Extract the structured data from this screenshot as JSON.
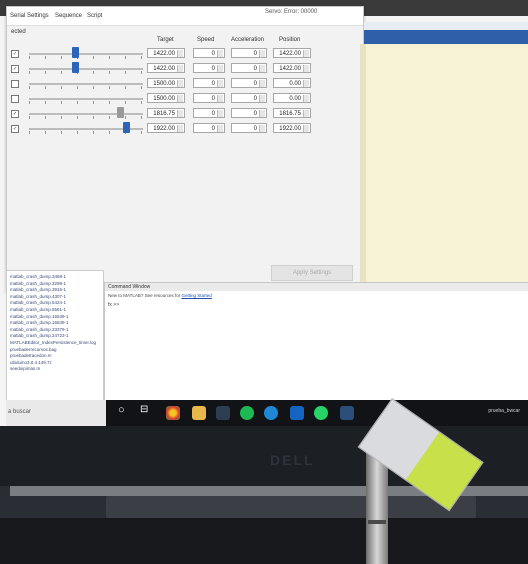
{
  "menubar": {
    "items": [
      "Serial Settings",
      "Sequence",
      "Script"
    ],
    "right_text": "Servo: Error: 00000"
  },
  "status_label": "ected",
  "columns": {
    "target": "Target",
    "speed": "Speed",
    "acceleration": "Acceleration",
    "position": "Position"
  },
  "channels": [
    {
      "checked": true,
      "slider_fraction": 0.4,
      "target": "1422.00",
      "speed": "0",
      "acceleration": "0",
      "position": "1422.00"
    },
    {
      "checked": true,
      "slider_fraction": 0.4,
      "target": "1422.00",
      "speed": "0",
      "acceleration": "0",
      "position": "1422.00"
    },
    {
      "checked": false,
      "slider_fraction": null,
      "target": "1500.00",
      "speed": "0",
      "acceleration": "0",
      "position": "0.00"
    },
    {
      "checked": false,
      "slider_fraction": null,
      "target": "1500.00",
      "speed": "0",
      "acceleration": "0",
      "position": "0.00"
    },
    {
      "checked": true,
      "slider_fraction": 0.8,
      "target": "1816.75",
      "speed": "0",
      "acceleration": "0",
      "position": "1816.75"
    },
    {
      "checked": true,
      "slider_fraction": 0.85,
      "target": "1922.00",
      "speed": "0",
      "acceleration": "0",
      "position": "1922.00"
    }
  ],
  "apply_button": "Apply Settings",
  "file_list": [
    "matlab_crash_dump.3468-1",
    "matlab_crash_dump.3299-1",
    "matlab_crash_dump.3916-1",
    "matlab_crash_dump.4307-1",
    "matlab_crash_dump.5424-1",
    "matlab_crash_dump.5561-1",
    "matlab_crash_dump.16539-1",
    "matlab_crash_dump.16639-1",
    "matlab_crash_dump.23379-1",
    "matlab_crash_dump.24723-1",
    "MATLABEditor_IndexPersistence_timer.log",
    "pruebaderrecursos.bag",
    "pruebadetracedon.m",
    "ubiduino3.0.4.149.7z",
    "seedoipimas.m"
  ],
  "command_window": {
    "title": "Command Window",
    "notice": "New to MATLAB? See resources for",
    "notice_link": "Getting Started",
    "prompt": "fx >>"
  },
  "taskbar": {
    "search_placeholder": "a buscar",
    "tray_text": "prueba_bwcar"
  },
  "laptop_logo": "DELL",
  "icons": [
    "circle-icon",
    "task-view-icon",
    "chrome-icon",
    "explorer-icon",
    "mail-icon",
    "spotify-icon",
    "edge-icon",
    "outlook-icon",
    "whatsapp-icon",
    "matlab-icon"
  ]
}
